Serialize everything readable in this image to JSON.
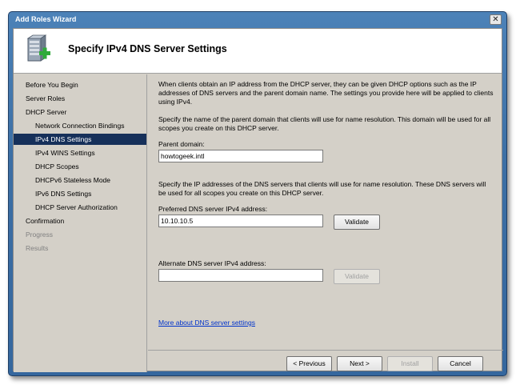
{
  "window": {
    "title": "Add Roles Wizard",
    "close_glyph": "✕"
  },
  "header": {
    "title": "Specify IPv4 DNS Server Settings",
    "icon": "server-add-icon"
  },
  "nav": {
    "items": [
      {
        "label": "Before You Begin",
        "level": 1,
        "state": "normal"
      },
      {
        "label": "Server Roles",
        "level": 1,
        "state": "normal"
      },
      {
        "label": "DHCP Server",
        "level": 1,
        "state": "normal"
      },
      {
        "label": "Network Connection Bindings",
        "level": 2,
        "state": "normal"
      },
      {
        "label": "IPv4 DNS Settings",
        "level": 2,
        "state": "selected"
      },
      {
        "label": "IPv4 WINS Settings",
        "level": 2,
        "state": "normal"
      },
      {
        "label": "DHCP Scopes",
        "level": 2,
        "state": "normal"
      },
      {
        "label": "DHCPv6 Stateless Mode",
        "level": 2,
        "state": "normal"
      },
      {
        "label": "IPv6 DNS Settings",
        "level": 2,
        "state": "normal"
      },
      {
        "label": "DHCP Server Authorization",
        "level": 2,
        "state": "normal"
      },
      {
        "label": "Confirmation",
        "level": 1,
        "state": "normal"
      },
      {
        "label": "Progress",
        "level": 1,
        "state": "disabled"
      },
      {
        "label": "Results",
        "level": 1,
        "state": "disabled"
      }
    ]
  },
  "content": {
    "intro": "When clients obtain an IP address from the DHCP server, they can be given DHCP options such as the IP addresses of DNS servers and the parent domain name. The settings you provide here will be applied to clients using IPv4.",
    "domain_instructions": "Specify the name of the parent domain that clients will use for name resolution. This domain will be used for all scopes you create on this DHCP server.",
    "parent_domain_label": "Parent domain:",
    "parent_domain_value": "howtogeek.intl",
    "dns_instructions": "Specify the IP addresses of the DNS servers that clients will use for name resolution. These DNS servers will be used for all scopes you create on this DHCP server.",
    "preferred_label": "Preferred DNS server IPv4 address:",
    "preferred_value": "10.10.10.5",
    "validate_label": "Validate",
    "alternate_label": "Alternate DNS server IPv4 address:",
    "alternate_value": "",
    "validate_alt_label": "Validate",
    "more_link": "More about DNS server settings"
  },
  "footer": {
    "previous": "< Previous",
    "next": "Next >",
    "install": "Install",
    "cancel": "Cancel"
  }
}
